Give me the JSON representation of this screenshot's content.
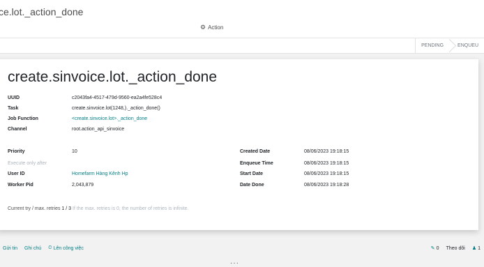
{
  "breadcrumb": "ce.lot._action_done",
  "action_button": "Action",
  "status_bar": [
    "PENDING",
    "ENQUEU"
  ],
  "title": "create.sinvoice.lot._action_done",
  "fields_top": [
    {
      "label": "UUID",
      "value": "c2043fa4-4517-479d-9560-ea2a4fe528c4",
      "link": false
    },
    {
      "label": "Task",
      "value": "create.sinvoice.lot(1248,)._action_done()",
      "link": false
    },
    {
      "label": "Job Function",
      "value": "<create.sinvoice.lot>._action_done",
      "link": true
    },
    {
      "label": "Channel",
      "value": "root.action_api_sinvoice",
      "link": false
    }
  ],
  "fields_left": [
    {
      "label": "Priority",
      "value": "10",
      "link": false,
      "muted": false
    },
    {
      "label": "Execute only after",
      "value": "",
      "link": false,
      "muted": true
    },
    {
      "label": "User ID",
      "value": "Homefarm Hàng Kênh Hp",
      "link": true,
      "muted": false
    },
    {
      "label": "Worker Pid",
      "value": "2,043,879",
      "link": false,
      "muted": false
    }
  ],
  "fields_right": [
    {
      "label": "Created Date",
      "value": "08/06/2023 19:18:15"
    },
    {
      "label": "Enqueue Time",
      "value": "08/06/2023 19:18:15"
    },
    {
      "label": "Start Date",
      "value": "08/06/2023 19:18:15"
    },
    {
      "label": "Date Done",
      "value": "08/06/2023 19:18:28"
    }
  ],
  "retry": {
    "label": "Current try / max. retries",
    "count": "1 / 3",
    "hint": "If the max. retries is 0, the number of retries is infinite."
  },
  "chatter": {
    "send_message": "Gửi tin",
    "log_note": "Ghi chú",
    "schedule_activity": "Lên công việc",
    "attachments": "0",
    "follow": "Theo dõi",
    "followers": "1"
  },
  "icons": {
    "action": "gear-icon",
    "schedule": "clock-icon",
    "attachments": "paperclip-icon",
    "followers": "user-icon"
  },
  "colors": {
    "accent": "#7a5473",
    "link": "#017e84"
  }
}
